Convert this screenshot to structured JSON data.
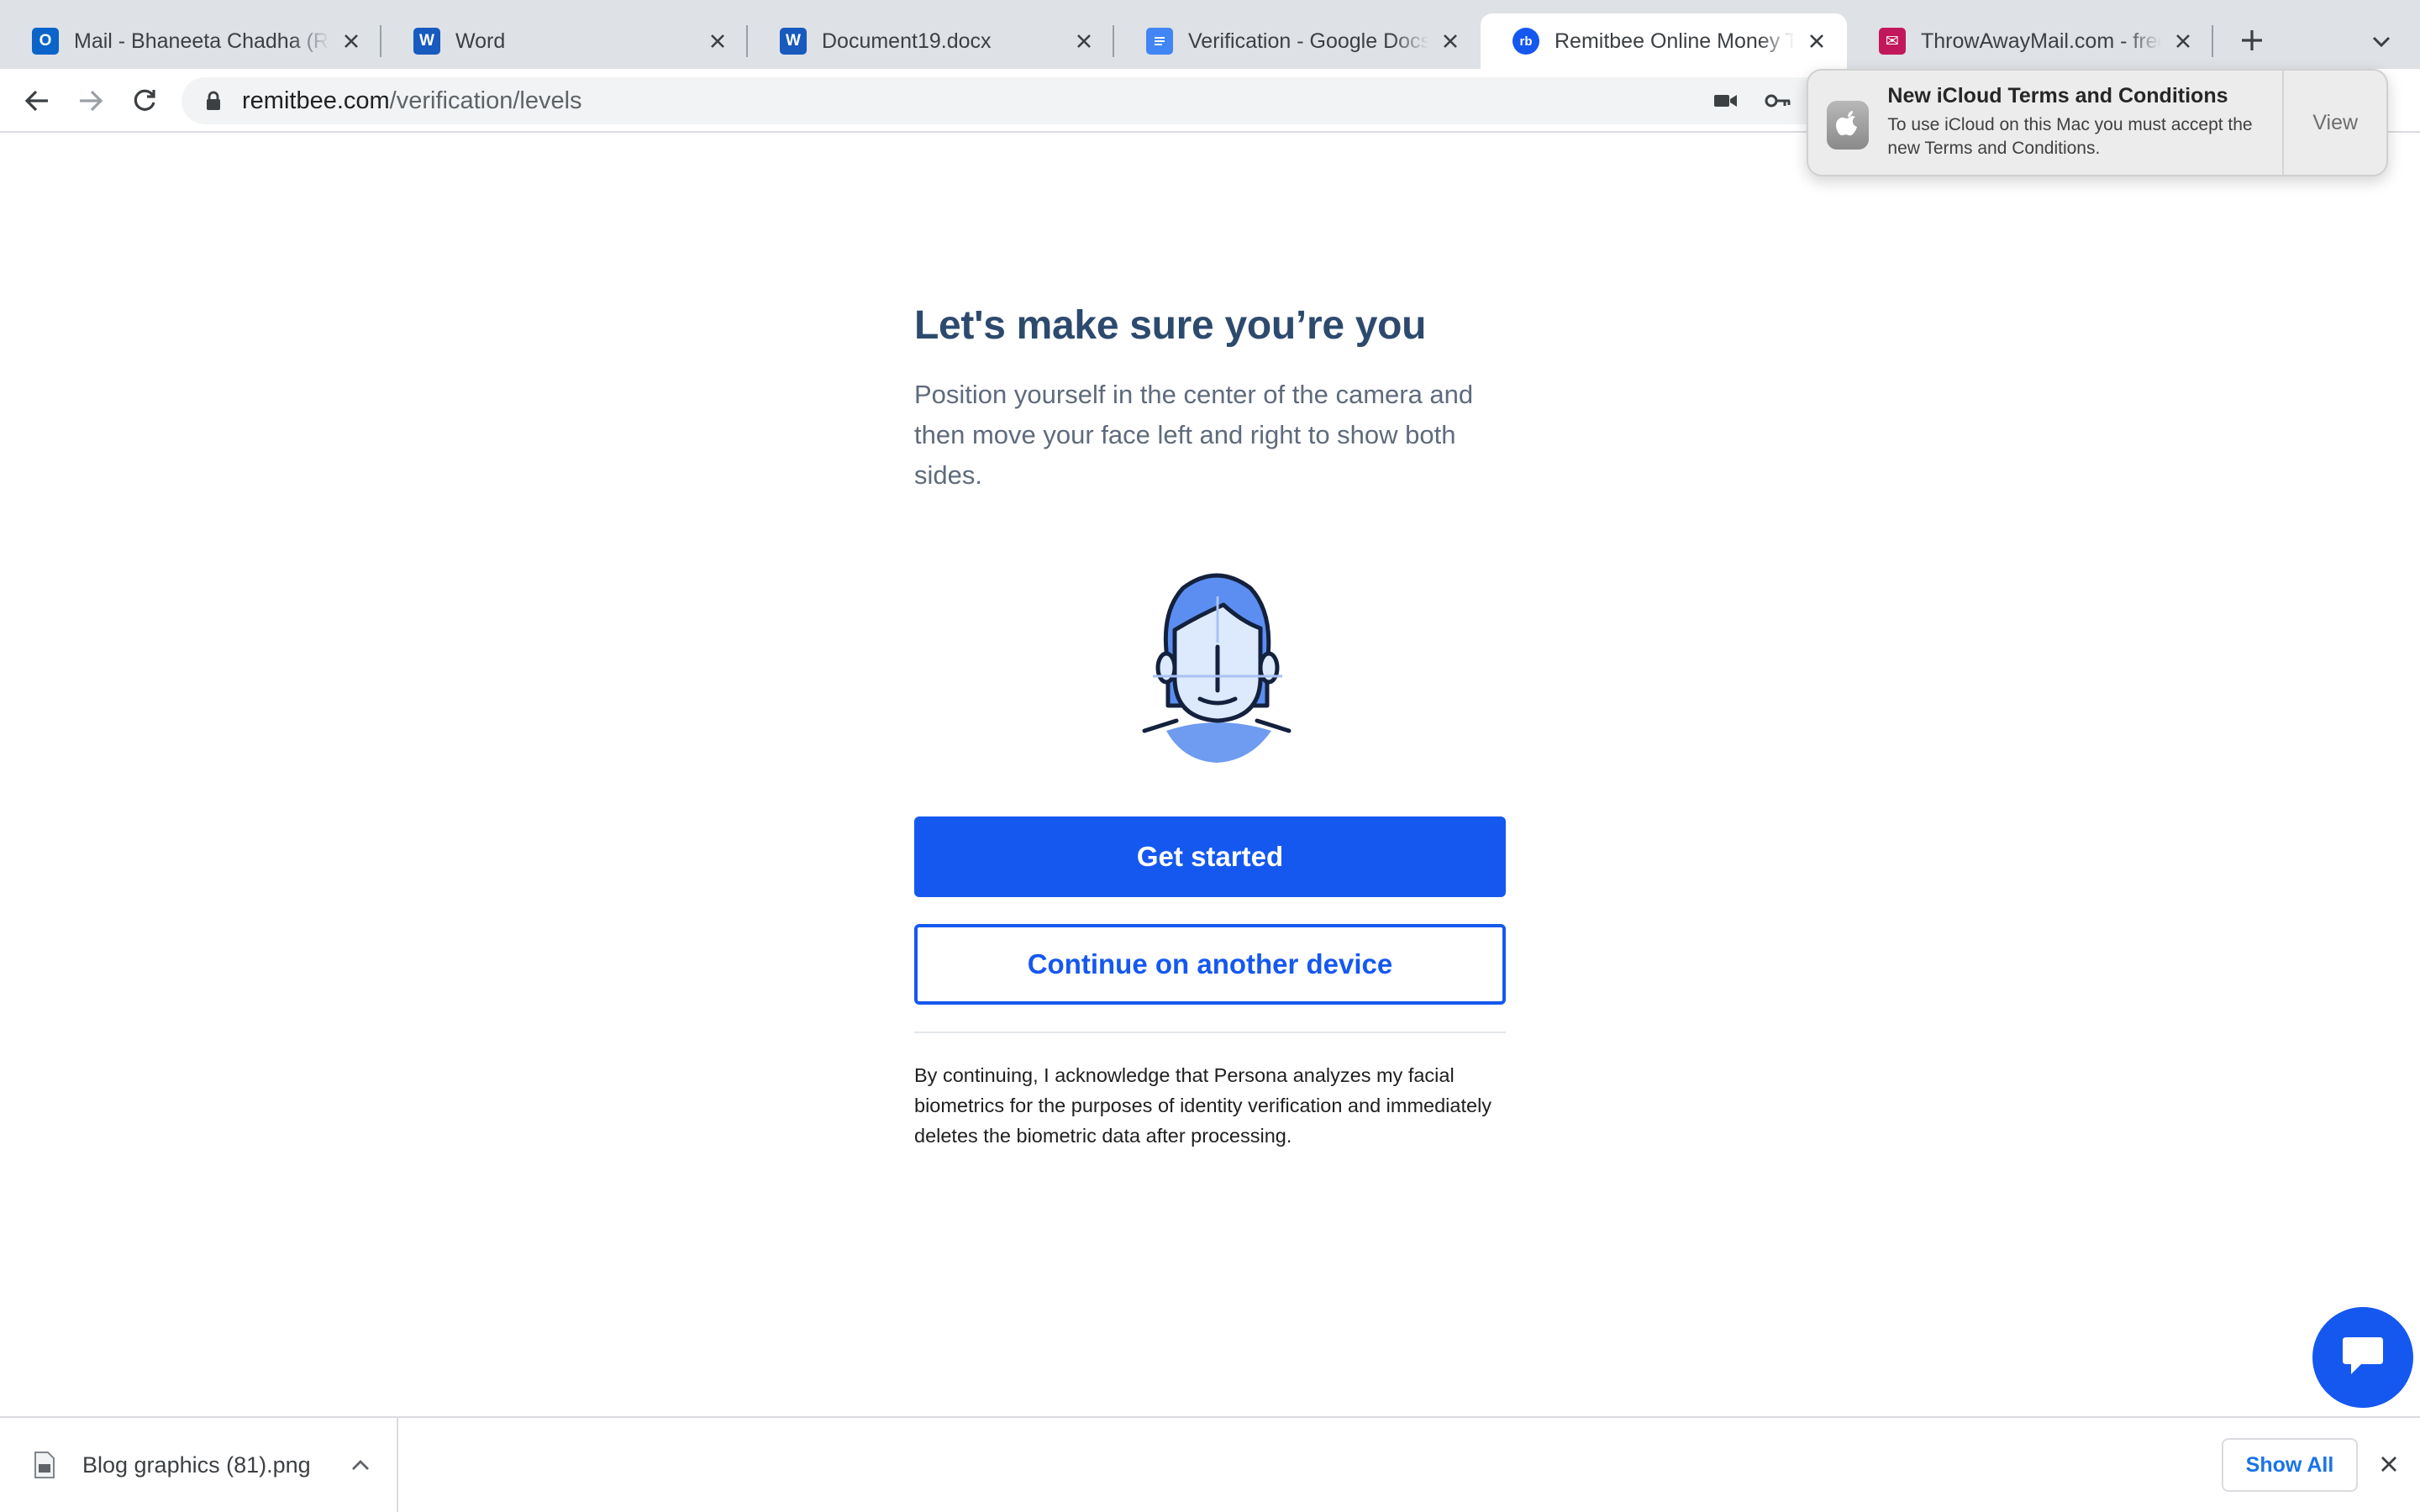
{
  "browser": {
    "tabs": [
      {
        "title": "Mail - Bhaneeta Chadha (Remitbee)",
        "icon": "outlook-icon",
        "color": "#0a64c9"
      },
      {
        "title": "Word",
        "icon": "word-icon",
        "color": "#185abd"
      },
      {
        "title": "Document19.docx",
        "icon": "word-icon",
        "color": "#185abd"
      },
      {
        "title": "Verification - Google Docs",
        "icon": "google-docs-icon",
        "color": "#4285f4"
      },
      {
        "title": "Remitbee Online Money Transfer",
        "icon": "remitbee-icon",
        "color": "#1558f0",
        "active": true
      },
      {
        "title": "ThrowAwayMail.com - free",
        "icon": "throwawaymail-icon",
        "color": "#c2185b"
      }
    ],
    "url_host": "remitbee.com",
    "url_path": "/verification/levels"
  },
  "notification": {
    "title": "New iCloud Terms and Conditions",
    "body": "To use iCloud on this Mac you must accept the new Terms and Conditions.",
    "action": "View",
    "icon": "apple-icon"
  },
  "page": {
    "heading": "Let's make sure you’re you",
    "description": "Position yourself in the center of the camera and then move your face left and right to show both sides.",
    "illustration": "face-scan-icon",
    "primary_button": "Get started",
    "secondary_button": "Continue on another device",
    "legal": "By continuing, I acknowledge that Persona analyzes my facial biometrics for the purposes of identity verification and immediately deletes the biometric data after processing.",
    "accent_color": "#1558f0",
    "heading_color": "#2d4a6e"
  },
  "chat_widget": {
    "icon": "chat-bubble-icon"
  },
  "download_shelf": {
    "file_name": "Blog graphics (81).png",
    "show_all": "Show All"
  }
}
